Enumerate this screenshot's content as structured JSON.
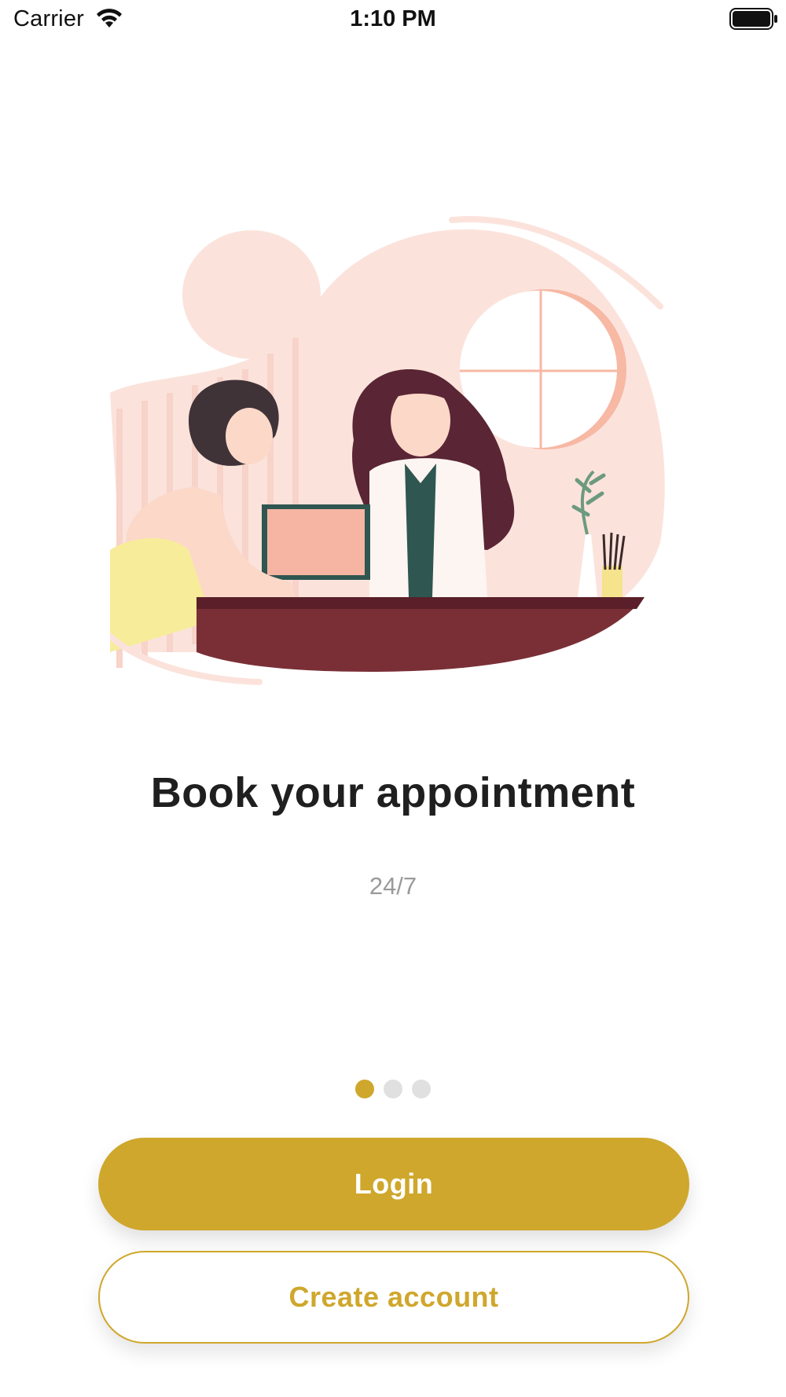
{
  "status_bar": {
    "carrier": "Carrier",
    "time": "1:10 PM",
    "icons": [
      "wifi-icon",
      "battery-icon"
    ]
  },
  "onboarding": {
    "title": "Book your appointment",
    "subtitle": "24/7",
    "page_indicator": {
      "current": 1,
      "total": 3
    }
  },
  "buttons": {
    "login_label": "Login",
    "create_account_label": "Create account"
  },
  "colors": {
    "accent": "#cfa72c",
    "dot_inactive": "#e0e0e0",
    "title": "#1f1f1f",
    "subtitle": "#9a9a9a",
    "illustration_blush": "#fbe3dc",
    "illustration_desk": "#7a2f36"
  }
}
